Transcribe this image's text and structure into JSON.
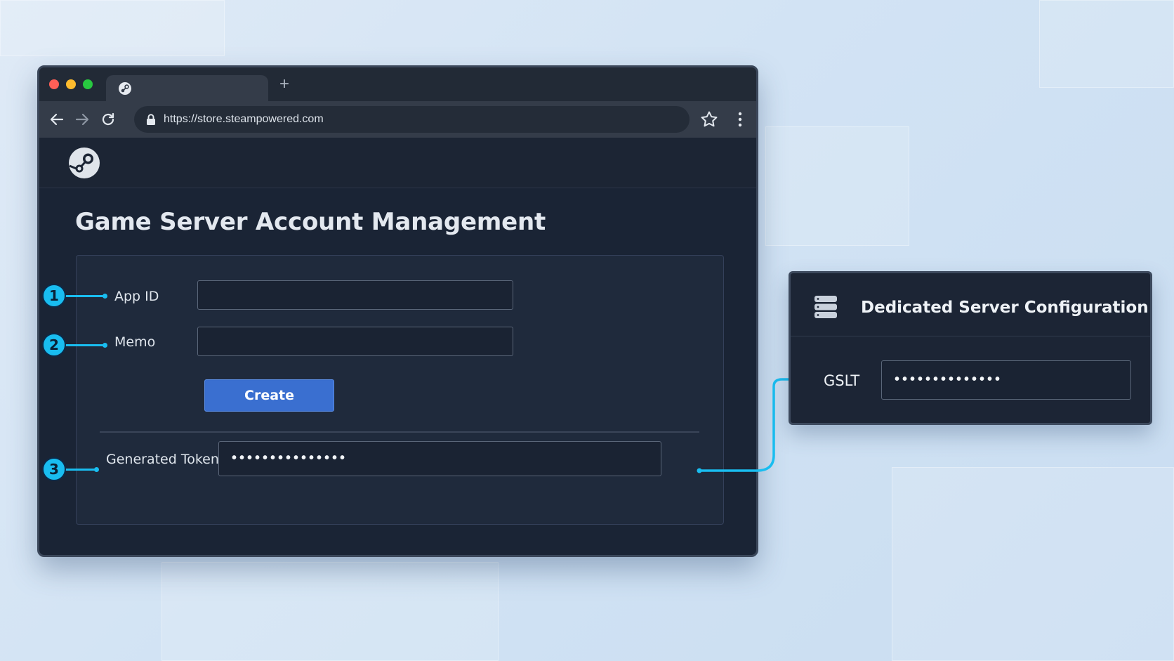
{
  "browser": {
    "url": "https://store.steampowered.com",
    "new_tab_glyph": "+"
  },
  "page": {
    "title": "Game Server Account Management",
    "fields": [
      {
        "badge": "1",
        "label": "App ID",
        "value": ""
      },
      {
        "badge": "2",
        "label": "Memo",
        "value": ""
      }
    ],
    "create_label": "Create",
    "token": {
      "badge": "3",
      "label": "Generated Token",
      "value": "•••••••••••••••"
    }
  },
  "config_panel": {
    "title": "Dedicated Server Configuration",
    "field_label": "GSLT",
    "field_value": "••••••••••••••"
  },
  "colors": {
    "accent": "#19bdf0",
    "button": "#3a6fd0",
    "panel_dark": "#1a2435"
  },
  "icons": [
    "steam-icon",
    "back-arrow-icon",
    "forward-arrow-icon",
    "reload-icon",
    "lock-icon",
    "star-icon",
    "more-vert-icon",
    "server-stack-icon"
  ]
}
